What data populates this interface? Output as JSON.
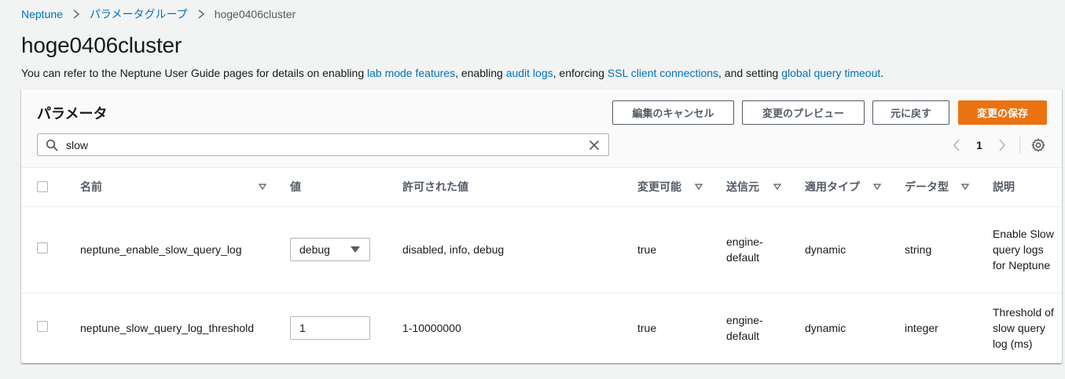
{
  "breadcrumb": {
    "root": "Neptune",
    "parent": "パラメータグループ",
    "current": "hoge0406cluster"
  },
  "page": {
    "title": "hoge0406cluster",
    "desc_1": "You can refer to the Neptune User Guide pages for details on enabling ",
    "link_1": "lab mode features",
    "desc_2": ", enabling ",
    "link_2": "audit logs",
    "desc_3": ", enforcing ",
    "link_3": "SSL client connections",
    "desc_4": ", and setting ",
    "link_4": "global query timeout",
    "desc_5": "."
  },
  "panel": {
    "title": "パラメータ",
    "buttons": {
      "cancel": "編集のキャンセル",
      "preview": "変更のプレビュー",
      "revert": "元に戻す",
      "save": "変更の保存"
    },
    "search_value": "slow",
    "page_number": "1"
  },
  "table": {
    "headers": {
      "name": "名前",
      "value": "値",
      "allowed": "許可された値",
      "modifiable": "変更可能",
      "source": "送信元",
      "apply_type": "適用タイプ",
      "data_type": "データ型",
      "description": "説明"
    },
    "rows": [
      {
        "name": "neptune_enable_slow_query_log",
        "value": "debug",
        "allowed": "disabled, info, debug",
        "modifiable": "true",
        "source": "engine-default",
        "apply_type": "dynamic",
        "data_type": "string",
        "description": "Enable Slow query logs for Neptune"
      },
      {
        "name": "neptune_slow_query_log_threshold",
        "value": "1",
        "allowed": "1-10000000",
        "modifiable": "true",
        "source": "engine-default",
        "apply_type": "dynamic",
        "data_type": "integer",
        "description": "Threshold of slow query log (ms)"
      }
    ]
  },
  "colors": {
    "link": "#0073bb",
    "primary": "#ec7211",
    "background": "#f2f3f3"
  },
  "icons": {
    "search": "search-icon",
    "clear": "close-icon",
    "prev": "chevron-left-icon",
    "next": "chevron-right-icon",
    "settings": "gear-icon",
    "sort": "caret-down-icon"
  }
}
